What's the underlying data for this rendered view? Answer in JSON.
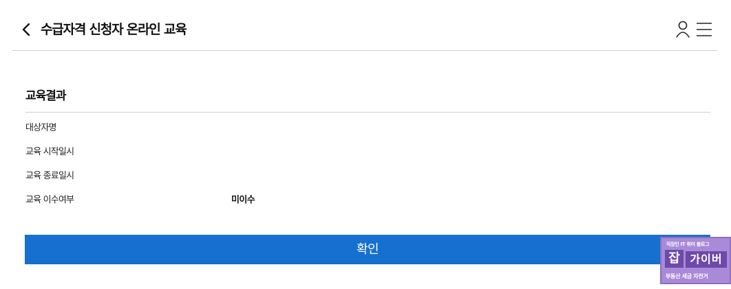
{
  "header": {
    "back_icon": "chevron-left-icon",
    "title": "수급자격 신청자 온라인 교육",
    "user_icon": "user-icon",
    "menu_icon": "hamburger-menu-icon"
  },
  "section": {
    "title": "교육결과"
  },
  "rows": [
    {
      "label": "대상자명",
      "value": ""
    },
    {
      "label": "교육 시작일시",
      "value": ""
    },
    {
      "label": "교육 종료일시",
      "value": ""
    },
    {
      "label": "교육 이수여부",
      "value": "미이수"
    }
  ],
  "confirm_label": "확인",
  "watermark": {
    "top_text": "직장인 IT 취미 블로그",
    "main_left": "잡",
    "main_right": "가이버",
    "bottom_text": "부동산 세금 자전거"
  },
  "colors": {
    "primary_button": "#1670cf",
    "divider": "#cfcfcf",
    "watermark_bg": "#a98ad8",
    "watermark_accent": "#6d49a9"
  }
}
